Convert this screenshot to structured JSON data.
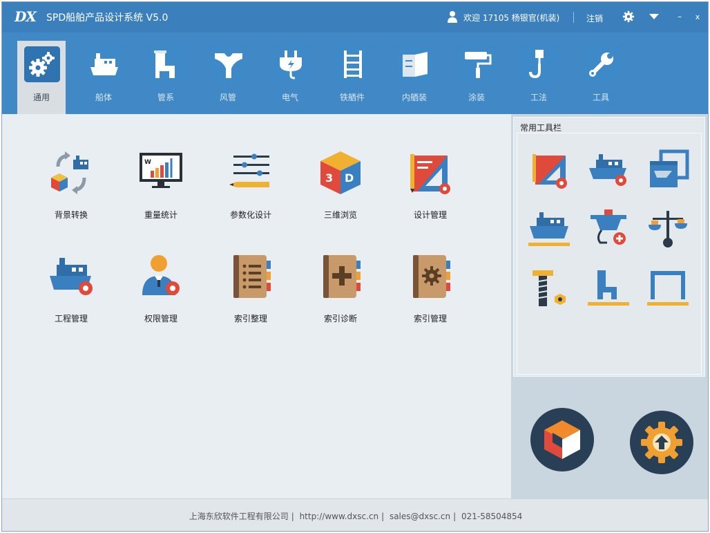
{
  "titlebar": {
    "logo": "DX",
    "title": "SPD船舶产品设计系统 V5.0",
    "welcome": "欢迎 17105 杨银官(机装)",
    "logout": "注销",
    "minimize": "–",
    "close": "x"
  },
  "ribbon": {
    "items": [
      {
        "label": "通用",
        "icon": "gears-icon",
        "active": true
      },
      {
        "label": "船体",
        "icon": "ship-hull-icon"
      },
      {
        "label": "管系",
        "icon": "pipe-icon"
      },
      {
        "label": "风管",
        "icon": "duct-icon"
      },
      {
        "label": "电气",
        "icon": "plug-icon"
      },
      {
        "label": "铁舾件",
        "icon": "ladder-icon"
      },
      {
        "label": "内舾装",
        "icon": "interior-icon"
      },
      {
        "label": "涂装",
        "icon": "paint-roller-icon"
      },
      {
        "label": "工法",
        "icon": "crane-hook-icon"
      },
      {
        "label": "工具",
        "icon": "wrench-icon"
      }
    ]
  },
  "main": {
    "tools": [
      {
        "label": "背景转换",
        "icon": "background-convert-icon"
      },
      {
        "label": "重量统计",
        "icon": "weight-statistics-icon"
      },
      {
        "label": "参数化设计",
        "icon": "parametric-design-icon"
      },
      {
        "label": "三维浏览",
        "icon": "3d-browse-icon"
      },
      {
        "label": "设计管理",
        "icon": "design-management-icon"
      },
      {
        "label": "工程管理",
        "icon": "project-management-icon"
      },
      {
        "label": "权限管理",
        "icon": "permission-management-icon"
      },
      {
        "label": "索引整理",
        "icon": "index-organize-icon"
      },
      {
        "label": "索引诊断",
        "icon": "index-diagnose-icon"
      },
      {
        "label": "索引管理",
        "icon": "index-management-icon"
      }
    ]
  },
  "favorites": {
    "title": "常用工具栏",
    "items": [
      "design-settings-icon",
      "ship-settings-icon",
      "window-tool-icon",
      "ship-ruler-icon",
      "electric-settings-icon",
      "balance-icon",
      "bolt-nut-icon",
      "pipe-ruler-icon",
      "frame-ruler-icon"
    ]
  },
  "round_buttons": [
    "cube-icon",
    "gear-upload-icon"
  ],
  "footer": {
    "company": "上海东欣软件工程有限公司",
    "url": "http://www.dxsc.cn",
    "email": "sales@dxsc.cn",
    "phone": "021-58504854"
  },
  "colors": {
    "titlebar": "#3b80bd",
    "ribbon": "#4088c6",
    "main_bg": "#e9eef3",
    "panel_bg": "#c9d5df",
    "round_button": "#293f55"
  }
}
